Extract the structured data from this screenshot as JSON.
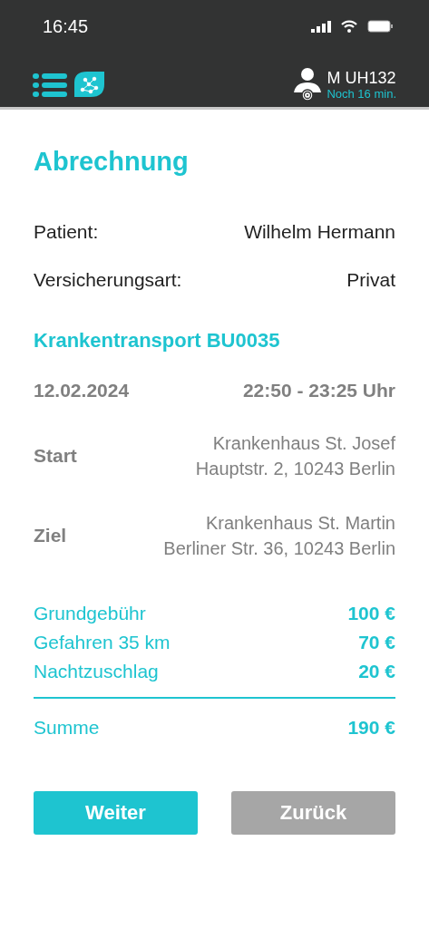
{
  "status_bar": {
    "time": "16:45"
  },
  "header": {
    "vehicle": "M UH132",
    "remaining": "Noch 16 min."
  },
  "title": "Abrechnung",
  "info": [
    {
      "label": "Patient:",
      "value": "Wilhelm Hermann"
    },
    {
      "label": "Versicherungsart:",
      "value": "Privat"
    }
  ],
  "transport": {
    "title": "Krankentransport BU0035",
    "date": "12.02.2024",
    "time": "22:50 - 23:25 Uhr",
    "stops": [
      {
        "label": "Start",
        "lines": [
          "Krankenhaus St. Josef",
          "Hauptstr. 2, 10243 Berlin"
        ]
      },
      {
        "label": "Ziel",
        "lines": [
          "Krankenhaus St. Martin",
          "Berliner Str. 36, 10243 Berlin"
        ]
      }
    ]
  },
  "fees": [
    {
      "label": "Grundgebühr",
      "amount": "100 €"
    },
    {
      "label": "Gefahren 35 km",
      "amount": "70 €"
    },
    {
      "label": "Nachtzuschlag",
      "amount": "20 €"
    }
  ],
  "total": {
    "label": "Summe",
    "amount": "190 €"
  },
  "buttons": [
    {
      "label": "Weiter",
      "kind": "primary"
    },
    {
      "label": "Zurück",
      "kind": "secondary"
    }
  ]
}
